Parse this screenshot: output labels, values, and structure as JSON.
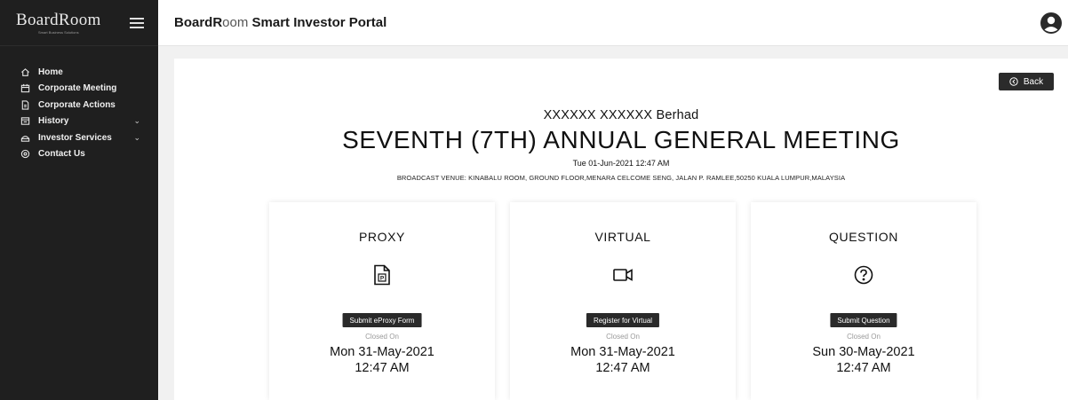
{
  "sidebar": {
    "logo_text": "BoardRoom",
    "logo_sub": "Smart Business Solutions",
    "items": [
      {
        "label": "Home",
        "icon": "home-icon",
        "has_caret": false
      },
      {
        "label": "Corporate Meeting",
        "icon": "calendar-icon",
        "has_caret": false
      },
      {
        "label": "Corporate Actions",
        "icon": "document-icon",
        "has_caret": false
      },
      {
        "label": "History",
        "icon": "history-icon",
        "has_caret": true
      },
      {
        "label": "Investor Services",
        "icon": "services-icon",
        "has_caret": true
      },
      {
        "label": "Contact Us",
        "icon": "location-icon",
        "has_caret": false
      }
    ],
    "caret": "⌄"
  },
  "header": {
    "title_part1": "BoardR",
    "title_accent": "oom",
    "title_part2": " Smart Investor Portal",
    "avatar_icon": "user-avatar-icon"
  },
  "main": {
    "back_label": "Back",
    "company": "XXXXXX XXXXXX Berhad",
    "meeting_title": "SEVENTH (7TH) ANNUAL GENERAL MEETING",
    "meeting_date": "Tue 01-Jun-2021 12:47 AM",
    "venue": "BROADCAST VENUE: KINABALU ROOM, GROUND FLOOR,MENARA CELCOME SENG, JALAN P. RAMLEE,50250 KUALA LUMPUR,MALAYSIA",
    "cards": [
      {
        "title": "PROXY",
        "icon": "proxy-document-icon",
        "button": "Submit eProxy Form",
        "closed_label": "Closed On",
        "date": "Mon 31-May-2021",
        "time": "12:47 AM"
      },
      {
        "title": "VIRTUAL",
        "icon": "video-camera-icon",
        "button": "Register for Virtual",
        "closed_label": "Closed On",
        "date": "Mon 31-May-2021",
        "time": "12:47 AM"
      },
      {
        "title": "QUESTION",
        "icon": "question-icon",
        "button": "Submit Question",
        "closed_label": "Closed On",
        "date": "Sun 30-May-2021",
        "time": "12:47 AM"
      }
    ]
  },
  "colors": {
    "sidebar_bg": "#1f1f1f",
    "button_bg": "#2a2a2a",
    "page_bg": "#f1f1f1"
  }
}
